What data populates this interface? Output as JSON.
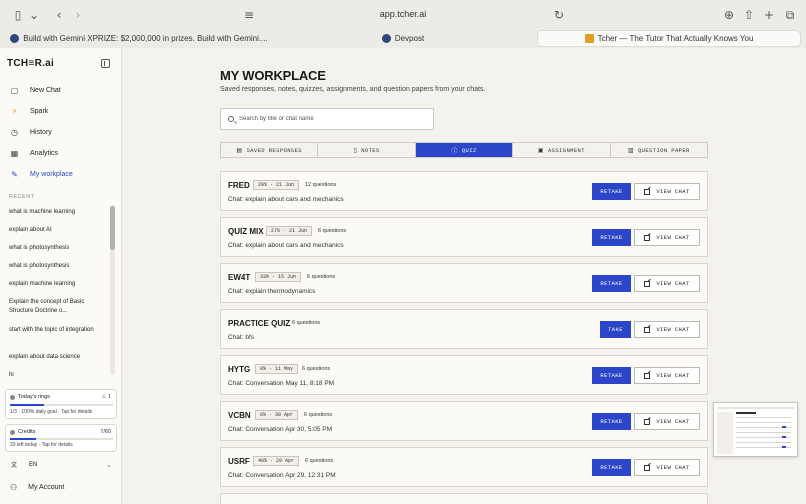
{
  "browser": {
    "url": "app.tcher.ai",
    "tabs": [
      {
        "label": "Build with Gemini XPRIZE: $2,000,000 in prizes. Build with Gemini...."
      },
      {
        "label": "Devpost"
      },
      {
        "label": "Tcher — The Tutor That Actually Knows You"
      }
    ]
  },
  "sidebar": {
    "brand": "TCH≡R.ai",
    "nav": [
      {
        "label": "New Chat",
        "icon": "new-chat-icon"
      },
      {
        "label": "Spark",
        "icon": "spark-icon"
      },
      {
        "label": "History",
        "icon": "history-icon"
      },
      {
        "label": "Analytics",
        "icon": "analytics-icon"
      },
      {
        "label": "My workplace",
        "icon": "workplace-icon"
      }
    ],
    "recent_heading": "RECENT",
    "recent": [
      "what is machine learning",
      "explain about AI",
      "what is photosynthesis",
      "what is photosynthesis",
      "explain machine learning",
      "Explain the concept of Basic Structure Doctrine o...",
      "start with the topic of integration",
      "explain about data science",
      "hi"
    ],
    "rings": {
      "title": "Today's rings",
      "count": "1",
      "progress": 0.33,
      "sub": "1/3 · 100% daily goal · Tap for details"
    },
    "credits": {
      "title": "Credits",
      "value": "7/60",
      "progress": 0.25,
      "sub": "33 left today · Tap for details"
    },
    "language": "EN",
    "account": "My Account"
  },
  "main": {
    "title": "MY WORKPLACE",
    "subtitle": "Saved responses, notes, quizzes, assignments, and question papers from your chats.",
    "search_placeholder": "Search by title or chat name",
    "tabs": [
      {
        "label": "SAVED RESPONSES",
        "icon": "document-icon"
      },
      {
        "label": "NOTES",
        "icon": "book-icon"
      },
      {
        "label": "QUIZ",
        "icon": "help-circle-icon"
      },
      {
        "label": "ASSIGNMENT",
        "icon": "clipboard-icon"
      },
      {
        "label": "QUESTION PAPER",
        "icon": "paper-icon"
      }
    ],
    "active_tab": "QUIZ",
    "view_chat_label": "VIEW CHAT",
    "quizzes": [
      {
        "name": "FRED",
        "meta": "29% · 21 Jun",
        "questions": "12 questions",
        "chat": "Chat: explain about cars and mechanics",
        "action": "RETAKE"
      },
      {
        "name": "QUIZ MIX",
        "meta": "27% · 21 Jun",
        "questions": "6 questions",
        "chat": "Chat: explain about cars and mechanics",
        "action": "RETAKE"
      },
      {
        "name": "EW4T",
        "meta": "33% · 15 Jun",
        "questions": "6 questions",
        "chat": "Chat: explain thermodynamics",
        "action": "RETAKE"
      },
      {
        "name": "PRACTICE QUIZ",
        "meta": "",
        "questions": "6 questions",
        "chat": "Chat: bfs",
        "action": "TAKE"
      },
      {
        "name": "HYTG",
        "meta": "0% · 11 May",
        "questions": "6 questions",
        "chat": "Chat: Conversation May 11, 8:18 PM",
        "action": "RETAKE"
      },
      {
        "name": "VCBN",
        "meta": "0% · 30 Apr",
        "questions": "6 questions",
        "chat": "Chat: Conversation Apr 30, 5:05 PM",
        "action": "RETAKE"
      },
      {
        "name": "USRF",
        "meta": "40% · 29 Apr",
        "questions": "6 questions",
        "chat": "Chat: Conversation Apr 29, 12:31 PM",
        "action": "RETAKE"
      }
    ]
  },
  "colors": {
    "accent": "#2b46c8",
    "background": "#f4f2ec"
  }
}
